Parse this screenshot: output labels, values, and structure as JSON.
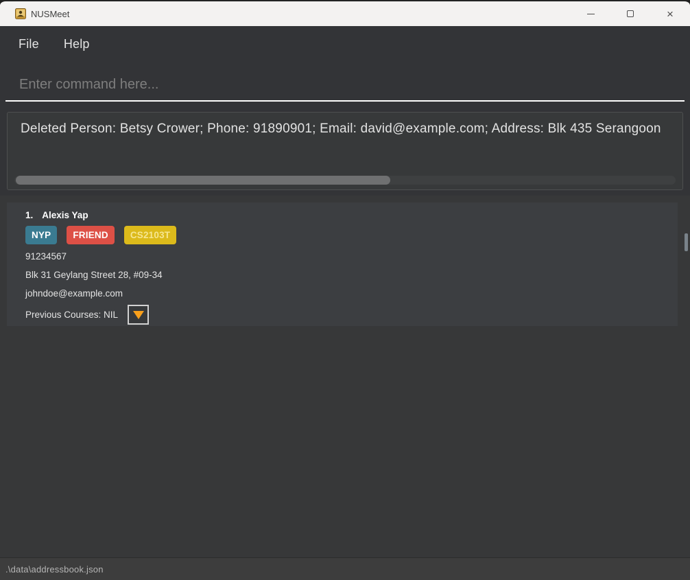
{
  "titlebar": {
    "title": "NUSMeet",
    "close_glyph": "×"
  },
  "menubar": {
    "items": [
      {
        "label": "File"
      },
      {
        "label": "Help"
      }
    ]
  },
  "command_box": {
    "value": "",
    "placeholder": "Enter command here..."
  },
  "result_display": {
    "text": "Deleted Person: Betsy Crower; Phone: 91890901; Email: david@example.com; Address: Blk 435 Serangoon"
  },
  "person_list": {
    "items": [
      {
        "index": "1.",
        "name": "Alexis Yap",
        "tags": [
          {
            "label": "NYP",
            "bg": "#3a7b91",
            "fg": "#ffffff"
          },
          {
            "label": "FRIEND",
            "bg": "#dd5046",
            "fg": "#ffffff"
          },
          {
            "label": "CS2103T",
            "bg": "#dcba1b",
            "fg": "#f6e690"
          }
        ],
        "phone": "91234567",
        "address": "Blk 31 Geylang Street 28, #09-34",
        "email": "johndoe@example.com",
        "courses_label": "Previous Courses: NIL"
      }
    ]
  },
  "status_bar": {
    "file_path": ".\\data\\addressbook.json"
  },
  "colors": {
    "expand_triangle_orange": "#f9a01b",
    "tag_teal": "#3a7b91",
    "tag_red": "#dd5046",
    "tag_gold": "#dcba1b",
    "titlebar_bg": "#f3f2f1",
    "dark_bg": "#333437",
    "card_bg": "#3c3e41"
  }
}
